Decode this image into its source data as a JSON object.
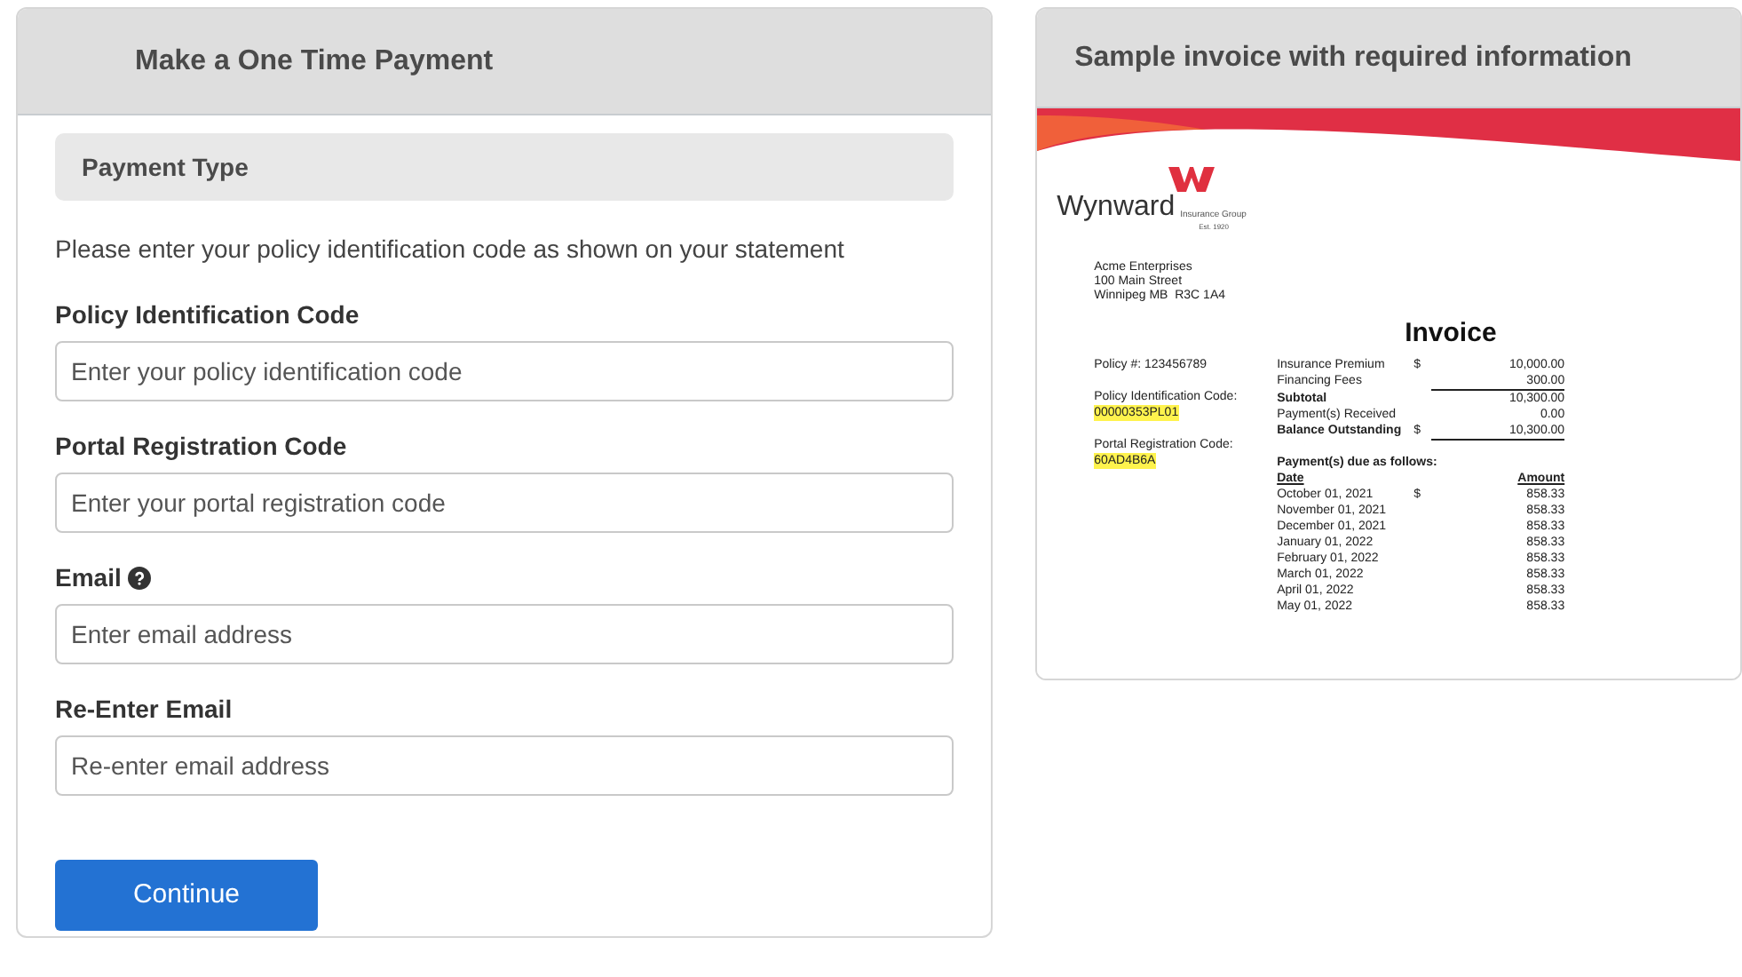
{
  "payment_panel": {
    "title": "Make a One Time Payment",
    "section": "Payment Type",
    "instruction": "Please enter your policy identification code as shown on your statement",
    "fields": [
      {
        "label": "Policy Identification Code",
        "placeholder": "Enter your policy identification code",
        "help": false
      },
      {
        "label": "Portal Registration Code",
        "placeholder": "Enter your portal registration code",
        "help": false
      },
      {
        "label": "Email",
        "placeholder": "Enter email address",
        "help": true
      },
      {
        "label": "Re-Enter Email",
        "placeholder": "Re-enter email address",
        "help": false
      }
    ],
    "button": "Continue"
  },
  "sample_panel": {
    "title": "Sample invoice with required information",
    "invoice": {
      "logo": {
        "name": "Wynward",
        "tagline": "Insurance Group",
        "established": "Est. 1920"
      },
      "address": [
        "Acme Enterprises",
        "100 Main Street",
        "Winnipeg MB  R3C 1A4"
      ],
      "title": "Invoice",
      "policy_number": "Policy #: 123456789",
      "codes": [
        {
          "label": "Policy Identification Code:",
          "value": "00000353PL01",
          "highlighted": true
        },
        {
          "label": "Portal Registration Code:",
          "value": "60AD4B6A",
          "highlighted": true
        }
      ],
      "summary": [
        {
          "label": "Insurance Premium",
          "currency": "$",
          "amount": "10,000.00",
          "bold": false,
          "ruled": false
        },
        {
          "label": "Financing Fees",
          "amount": "300.00",
          "bold": false,
          "ruled": true
        },
        {
          "label": "Subtotal",
          "amount": "10,300.00",
          "bold": true,
          "ruled": false
        },
        {
          "label": "Payment(s) Received",
          "amount": "0.00",
          "bold": false,
          "ruled": false
        },
        {
          "label": "Balance Outstanding",
          "currency": "$",
          "amount": "10,300.00",
          "bold": true,
          "ruled": true
        }
      ],
      "schedule": {
        "heading": "Payment(s) due as follows:",
        "columns": [
          "Date",
          "Amount"
        ],
        "rows": [
          {
            "date": "October 01, 2021",
            "currency": "$",
            "amount": "858.33"
          },
          {
            "date": "November 01, 2021",
            "amount": "858.33"
          },
          {
            "date": "December 01, 2021",
            "amount": "858.33"
          },
          {
            "date": "January 01, 2022",
            "amount": "858.33"
          },
          {
            "date": "February 01, 2022",
            "amount": "858.33"
          },
          {
            "date": "March 01, 2022",
            "amount": "858.33"
          },
          {
            "date": "April 01, 2022",
            "amount": "858.33"
          },
          {
            "date": "May 01, 2022",
            "amount": "858.33"
          }
        ]
      }
    }
  }
}
